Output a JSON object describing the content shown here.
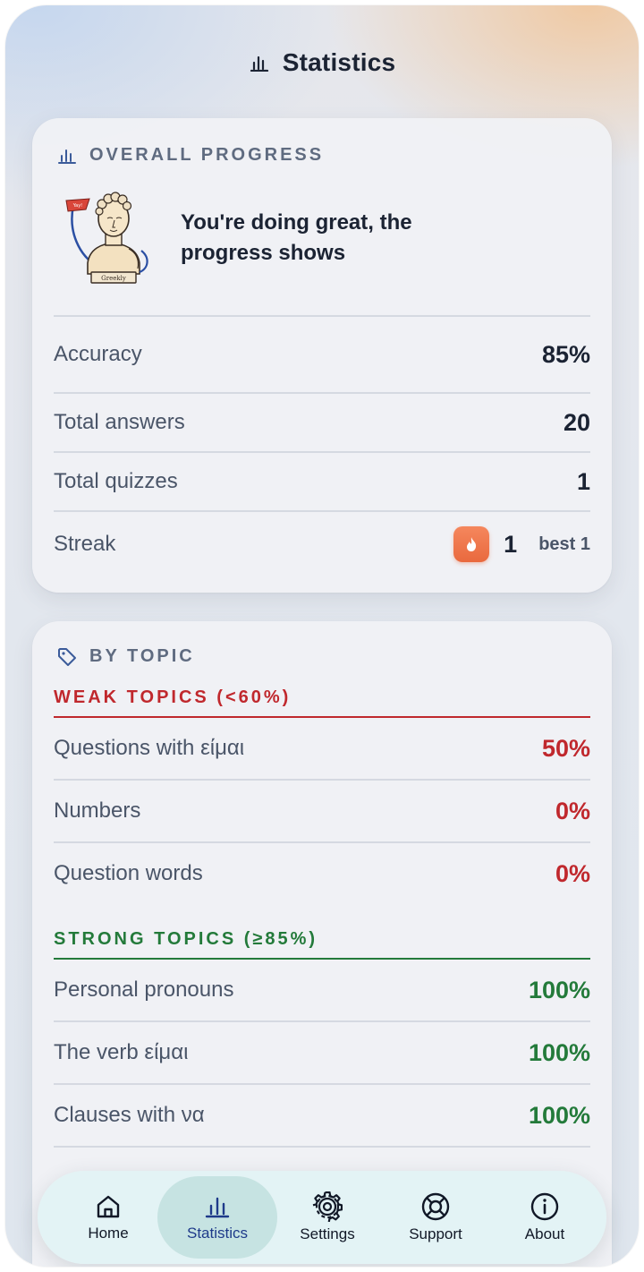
{
  "header": {
    "title": "Statistics",
    "icon": "bar-chart-icon"
  },
  "overall": {
    "label": "OVERALL PROGRESS",
    "icon": "bar-chart-icon",
    "mascot_text": "Greekly",
    "flag_text": "Yay!",
    "message": "You're doing great, the progress shows",
    "stats": [
      {
        "label": "Accuracy",
        "value": "85%"
      },
      {
        "label": "Total answers",
        "value": "20"
      },
      {
        "label": "Total quizzes",
        "value": "1"
      }
    ],
    "streak": {
      "label": "Streak",
      "value": "1",
      "best": "best 1",
      "icon": "flame-icon",
      "color": "#ee7246"
    }
  },
  "by_topic": {
    "label": "BY TOPIC",
    "icon": "tag-icon",
    "weak": {
      "heading": "WEAK TOPICS (<60%)",
      "color": "#c0282d",
      "items": [
        {
          "name": "Questions with είμαι",
          "value": "50%"
        },
        {
          "name": "Numbers",
          "value": "0%"
        },
        {
          "name": "Question words",
          "value": "0%"
        }
      ]
    },
    "strong": {
      "heading": "STRONG TOPICS (≥85%)",
      "color": "#237a3a",
      "items": [
        {
          "name": "Personal pronouns",
          "value": "100%"
        },
        {
          "name": "The verb είμαι",
          "value": "100%"
        },
        {
          "name": "Clauses with να",
          "value": "100%"
        }
      ]
    }
  },
  "tabbar": {
    "active": "Statistics",
    "tabs": [
      {
        "label": "Home",
        "icon": "home-icon"
      },
      {
        "label": "Statistics",
        "icon": "bar-chart-icon"
      },
      {
        "label": "Settings",
        "icon": "gear-icon"
      },
      {
        "label": "Support",
        "icon": "lifebuoy-icon"
      },
      {
        "label": "About",
        "icon": "info-icon"
      }
    ]
  }
}
